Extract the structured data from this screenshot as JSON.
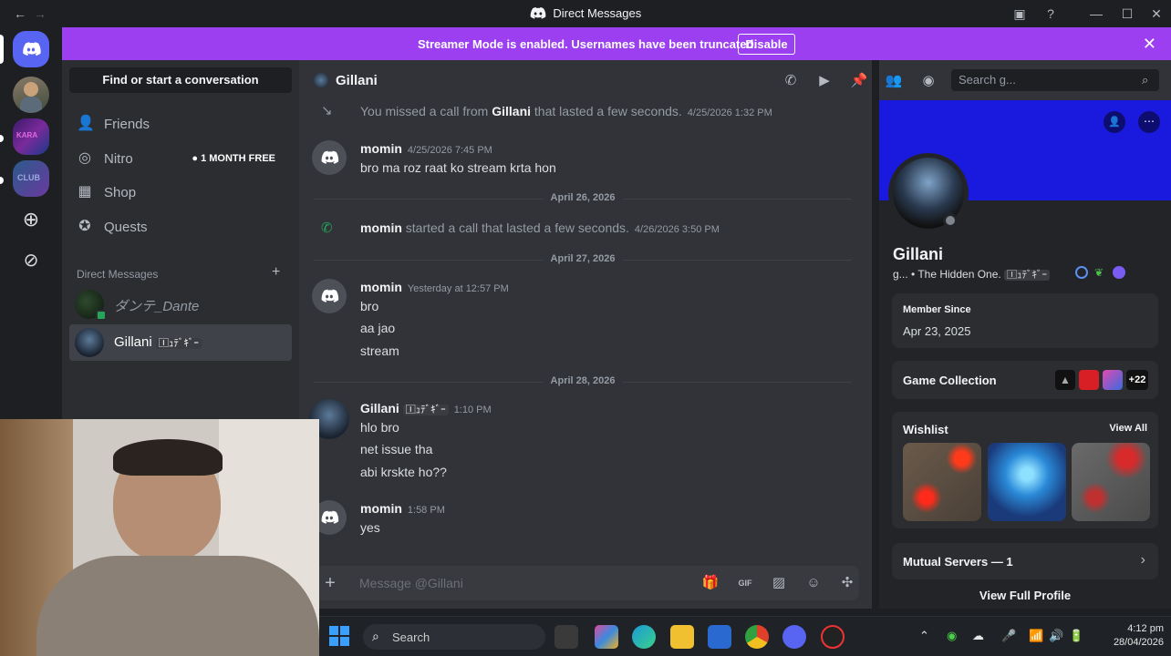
{
  "window": {
    "title": "Direct Messages"
  },
  "banner": {
    "message": "Streamer Mode is enabled. Usernames have been truncated.",
    "button": "Disable"
  },
  "dm_panel": {
    "find_placeholder": "Find or start a conversation",
    "nav": [
      {
        "label": "Friends",
        "icon": "friends-icon"
      },
      {
        "label": "Nitro",
        "icon": "nitro-icon",
        "badge": "1 MONTH FREE"
      },
      {
        "label": "Shop",
        "icon": "shop-icon"
      },
      {
        "label": "Quests",
        "icon": "quests-icon"
      }
    ],
    "section_header": "Direct Messages",
    "dms": [
      {
        "name": "ダンテ_Dante"
      },
      {
        "name": "Gillani",
        "tag": "🄸ｭﾃﾞｷﾞｰ"
      }
    ]
  },
  "chat": {
    "channel_name": "Gillani",
    "messages": {
      "missed_call": {
        "prefix": "You missed a call from ",
        "name": "Gillani",
        "suffix": " that lasted a few seconds.",
        "timestamp": "4/25/2026 1:32 PM"
      },
      "m1": {
        "author": "momin",
        "timestamp": "4/25/2026 7:45 PM",
        "lines": [
          "bro ma roz raat ko stream krta hon"
        ]
      },
      "date1": "April 26, 2026",
      "call": {
        "name": "momin",
        "text": " started a call that lasted a few seconds.",
        "timestamp": "4/26/2026 3:50 PM"
      },
      "date2": "April 27, 2026",
      "m2": {
        "author": "momin",
        "timestamp": "Yesterday at 12:57 PM",
        "lines": [
          "bro",
          "aa jao",
          "stream"
        ]
      },
      "date3": "April 28, 2026",
      "m3": {
        "author": "Gillani",
        "tag": "🄸ｭﾃﾞｷﾞｰ",
        "timestamp": "1:10 PM",
        "lines": [
          "hlo bro",
          "net issue tha",
          "abi krskte ho??"
        ]
      },
      "m4": {
        "author": "momin",
        "timestamp": "1:58 PM",
        "lines": [
          "yes"
        ]
      }
    },
    "composer_placeholder": "Message @Gillani"
  },
  "profile": {
    "search_placeholder": "Search g...",
    "name": "Gillani",
    "subline": "g... • The Hidden One.",
    "tag": "🄸ｭﾃﾞｷﾞｰ",
    "member_since_label": "Member Since",
    "member_since": "Apr 23, 2025",
    "game_collection": "Game Collection",
    "game_more": "+22",
    "wishlist": "Wishlist",
    "view_all": "View All",
    "mutual_servers": "Mutual Servers — 1",
    "view_full": "View Full Profile"
  },
  "taskbar": {
    "search": "Search",
    "time": "4:12 pm",
    "date": "28/04/2026"
  },
  "colors": {
    "banner": "#9b3ff0",
    "profile_banner": "#1a1adf",
    "blurple": "#5865f2",
    "call_green": "#23a55a"
  }
}
